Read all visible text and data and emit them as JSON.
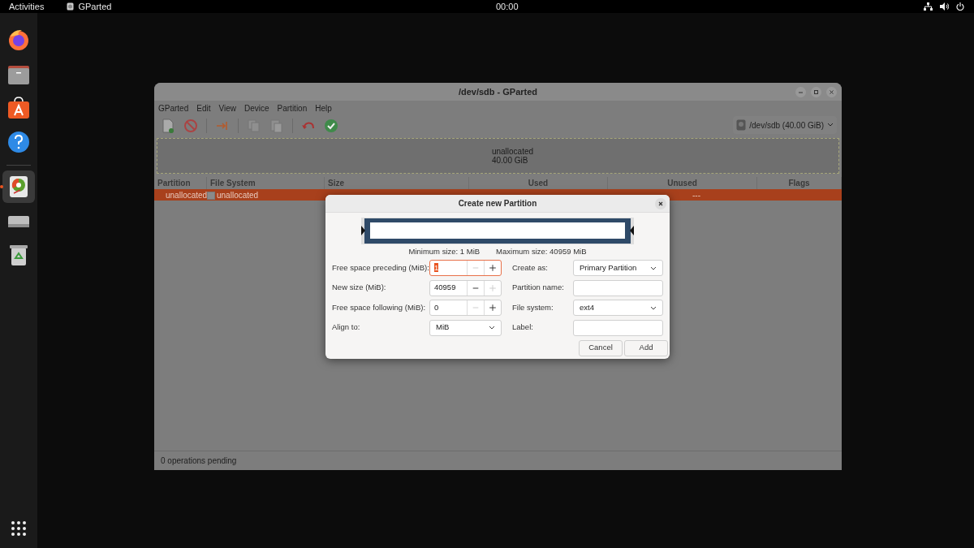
{
  "top_bar": {
    "activities": "Activities",
    "app_name": "GParted",
    "clock": "00:00"
  },
  "dock": {
    "items": [
      {
        "kind": "firefox",
        "running": false
      },
      {
        "kind": "files",
        "running": false
      },
      {
        "kind": "store",
        "running": false
      },
      {
        "kind": "help",
        "running": false
      },
      {
        "kind": "gparted",
        "running": true
      },
      {
        "kind": "drive",
        "running": false
      },
      {
        "kind": "trash",
        "running": false
      }
    ]
  },
  "window": {
    "title": "/dev/sdb - GParted",
    "menu": [
      "GParted",
      "Edit",
      "View",
      "Device",
      "Partition",
      "Help"
    ],
    "device_selector": "/dev/sdb (40.00 GiB)",
    "partition_map": {
      "label": "unallocated",
      "size": "40.00 GiB"
    },
    "table": {
      "columns": [
        "Partition",
        "File System",
        "Size",
        "Used",
        "Unused",
        "Flags"
      ],
      "rows": [
        {
          "partition": "unallocated",
          "file_system": "unallocated",
          "unused": "---",
          "selected": true
        }
      ]
    },
    "status_bar": "0 operations pending"
  },
  "dialog": {
    "title": "Create new Partition",
    "min_size": "Minimum size: 1 MiB",
    "max_size": "Maximum size: 40959 MiB",
    "left_fields": [
      {
        "kind": "spin",
        "label": "Free space preceding (MiB):",
        "value": "1",
        "focused": true,
        "minus_enabled": false,
        "plus_enabled": true
      },
      {
        "kind": "spin",
        "label": "New size (MiB):",
        "value": "40959",
        "focused": false,
        "minus_enabled": true,
        "plus_enabled": false
      },
      {
        "kind": "spin",
        "label": "Free space following (MiB):",
        "value": "0",
        "focused": false,
        "minus_enabled": false,
        "plus_enabled": true
      },
      {
        "kind": "combo",
        "label": "Align to:",
        "value": "MiB"
      }
    ],
    "right_fields": [
      {
        "kind": "combo",
        "label": "Create as:",
        "value": "Primary Partition"
      },
      {
        "kind": "entry",
        "label": "Partition name:"
      },
      {
        "kind": "combo",
        "label": "File system:",
        "value": "ext4"
      },
      {
        "kind": "entry",
        "label": "Label:"
      }
    ],
    "buttons": [
      "Cancel",
      "Add"
    ]
  }
}
